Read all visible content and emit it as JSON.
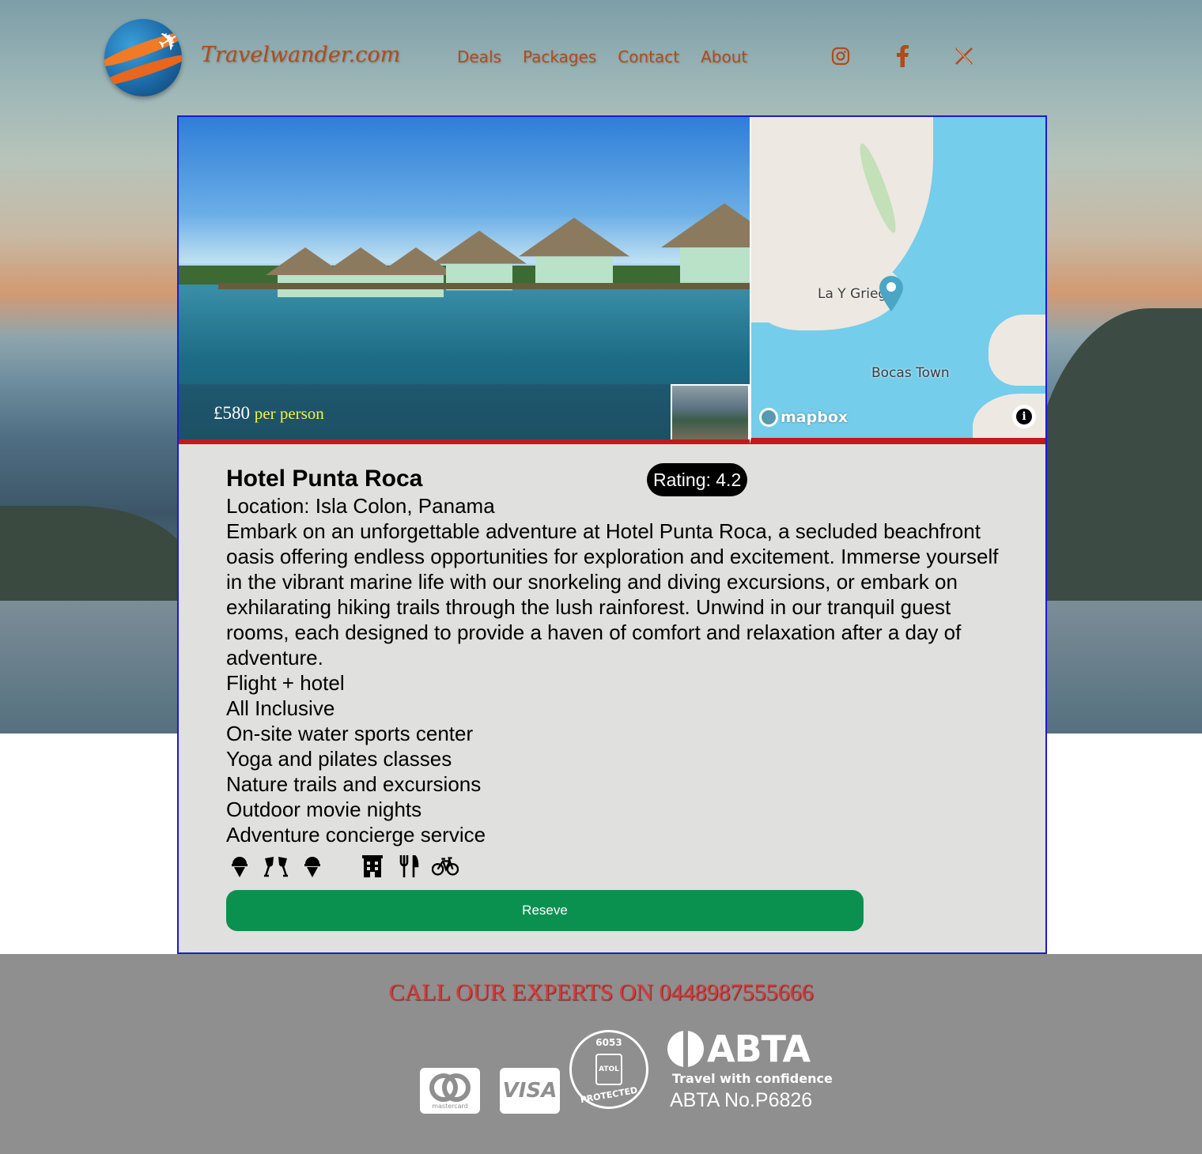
{
  "header": {
    "brand": "Travelwander.com",
    "nav": [
      {
        "label": "Deals"
      },
      {
        "label": "Packages"
      },
      {
        "label": "Contact"
      },
      {
        "label": "About"
      }
    ],
    "social": [
      "instagram-icon",
      "facebook-icon",
      "x-icon"
    ]
  },
  "listing": {
    "price": "£580",
    "price_unit": "per person",
    "map": {
      "labels": [
        "La Y Griega",
        "Bocas Town"
      ],
      "attribution": "mapbox"
    },
    "name": "Hotel Punta Roca",
    "rating": "Rating: 4.2",
    "location": "Location: Isla Colon, Panama",
    "description": "Embark on an unforgettable adventure at Hotel Punta Roca, a secluded beachfront oasis offering endless opportunities for exploration and excitement. Immerse yourself in the vibrant marine life with our snorkeling and diving excursions, or embark on exhilarating hiking trails through the lush rainforest. Unwind in our tranquil guest rooms, each designed to provide a haven of comfort and relaxation after a day of adventure.",
    "features": [
      "Flight + hotel",
      "All Inclusive",
      "On-site water sports center",
      "Yoga and pilates classes",
      "Nature trails and excursions",
      "Outdoor movie nights",
      "Adventure concierge service"
    ],
    "amenity_icons": [
      "ice-cream-icon",
      "cocktails-icon",
      "ice-cream-icon",
      "hotel-building-icon",
      "restaurant-icon",
      "bicycle-icon"
    ],
    "reserve_label": "Reseve"
  },
  "footer": {
    "call_text": "CALL OUR EXPERTS ON 0448987555666",
    "payment": [
      "mastercard",
      "VISA"
    ],
    "mastercard_label": "mastercard",
    "atol": {
      "number": "6053",
      "brand": "ATOL",
      "text": "PROTECTED"
    },
    "abta": {
      "brand": "ABTA",
      "tagline": "Travel with confidence",
      "number": "ABTA No.P6826"
    }
  }
}
